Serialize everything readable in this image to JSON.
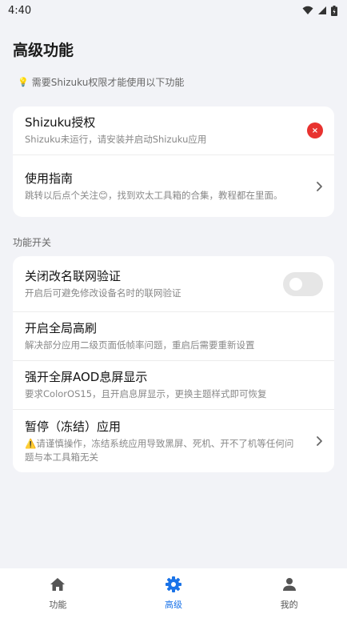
{
  "status_bar": {
    "time": "4:40"
  },
  "page": {
    "title": "高级功能",
    "notice_icon": "💡",
    "notice_text": "需要Shizuku权限才能使用以下功能"
  },
  "card_top": {
    "items": [
      {
        "title": "Shizuku授权",
        "desc": "Shizuku未运行，请安装并启动Shizuku应用",
        "action": "error-icon"
      },
      {
        "title": "使用指南",
        "desc": "跳转以后点个关注😊，找到欢太工具箱的合集，教程都在里面。",
        "action": "chevron-right-icon"
      }
    ]
  },
  "section": {
    "label": "功能开关"
  },
  "card_features": {
    "items": [
      {
        "title": "关闭改名联网验证",
        "desc": "开启后可避免修改设备名时的联网验证",
        "action": "toggle",
        "enabled": false
      },
      {
        "title": "开启全局高刷",
        "desc": "解决部分应用二级页面低帧率问题，重启后需要重新设置"
      },
      {
        "title": "强开全屏AOD息屏显示",
        "desc": "要求ColorOS15，且开启息屏显示，更换主题样式即可恢复"
      },
      {
        "title": "暂停（冻结）应用",
        "desc": "⚠️请谨慎操作，冻结系统应用导致黑屏、死机、开不了机等任何问题与本工具箱无关",
        "action": "chevron-right-icon"
      }
    ]
  },
  "bottom_nav": {
    "items": [
      {
        "label": "功能",
        "icon": "home-icon"
      },
      {
        "label": "高级",
        "icon": "gear-icon",
        "active": true
      },
      {
        "label": "我的",
        "icon": "person-icon"
      }
    ]
  },
  "colors": {
    "accent": "#1a73e8",
    "error": "#e8322f",
    "background": "#f2f3f7"
  }
}
